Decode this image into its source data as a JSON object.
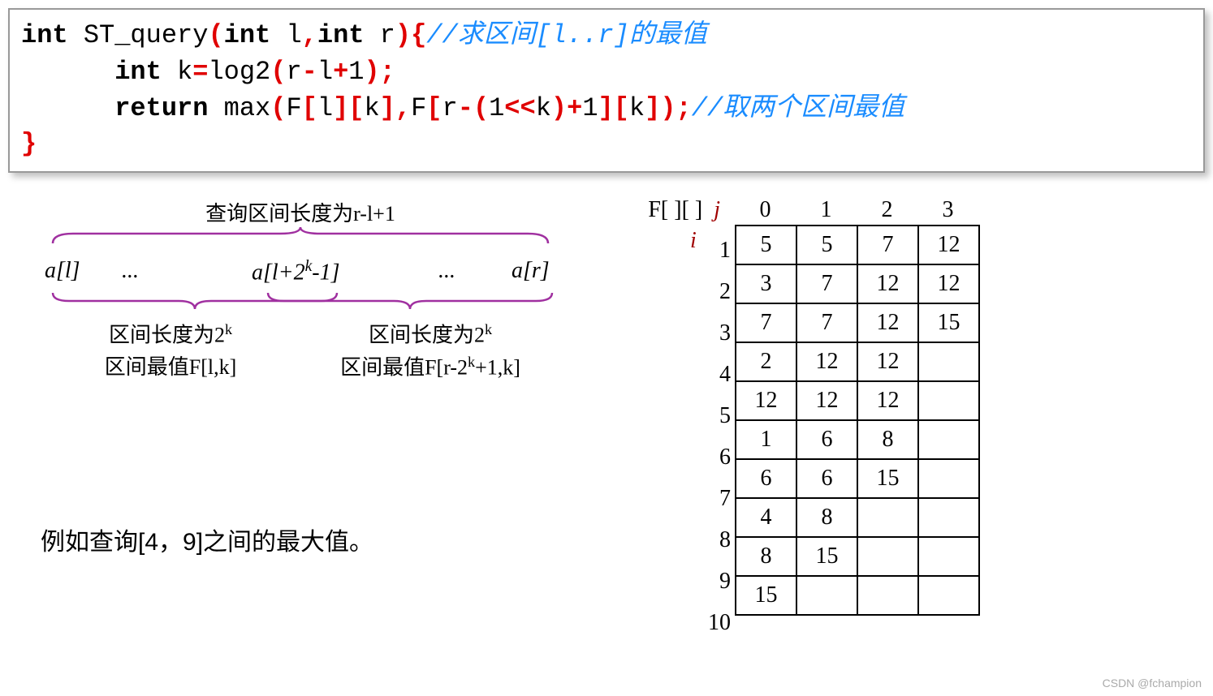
{
  "code": {
    "l1_kw1": "int",
    "l1_fn": " ST_query",
    "l1_paren_open": "(",
    "l1_kw2": "int",
    "l1_arg1": " l",
    "l1_comma": ",",
    "l1_kw3": "int",
    "l1_arg2": " r",
    "l1_paren_close": ")",
    "l1_brace": "{",
    "l1_comment": "//求区间[l..r]的最值",
    "l2_kw": "int",
    "l2_expr_a": " k",
    "l2_eq": "=",
    "l2_expr_b": "log2",
    "l2_po": "(",
    "l2_expr_c": "r",
    "l2_minus": "-",
    "l2_expr_d": "l",
    "l2_plus": "+",
    "l2_expr_e": "1",
    "l2_pc": ")",
    "l2_semi": ";",
    "l3_kw": "return",
    "l3_a": " max",
    "l3_po": "(",
    "l3_b": "F",
    "l3_br1": "[",
    "l3_c": "l",
    "l3_br2": "][",
    "l3_d": "k",
    "l3_br3": "],",
    "l3_e": "F",
    "l3_br4": "[",
    "l3_f": "r",
    "l3_minus": "-(",
    "l3_g": "1",
    "l3_shift": "<<",
    "l3_h": "k",
    "l3_cp": ")+",
    "l3_i": "1",
    "l3_br5": "][",
    "l3_j": "k",
    "l3_br6": "])",
    "l3_semi": ";",
    "l3_comment": "//取两个区间最值",
    "l4_brace": "}"
  },
  "diagram": {
    "top_label": "查询区间长度为r-l+1",
    "axis_al": "a[l]",
    "axis_dots1": "...",
    "axis_mid": "a[l+2",
    "axis_mid_sup": "k",
    "axis_mid_tail": "-1]",
    "axis_dots2": "...",
    "axis_ar": "a[r]",
    "sub_left_1a": "区间长度为2",
    "sub_left_1_sup": "k",
    "sub_left_2": "区间最值F[l,k]",
    "sub_right_1a": "区间长度为2",
    "sub_right_1_sup": "k",
    "sub_right_2a": "区间最值F[r-2",
    "sub_right_2_sup": "k",
    "sub_right_2b": "+1,k]"
  },
  "example": "例如查询[4，9]之间的最大值。",
  "table": {
    "corner": "F[ ][ ]",
    "j_label": "j",
    "i_label": "i",
    "col_headers": [
      "0",
      "1",
      "2",
      "3"
    ],
    "row_headers": [
      "1",
      "2",
      "3",
      "4",
      "5",
      "6",
      "7",
      "8",
      "9",
      "10"
    ],
    "rows": [
      [
        "5",
        "5",
        "7",
        "12"
      ],
      [
        "3",
        "7",
        "12",
        "12"
      ],
      [
        "7",
        "7",
        "12",
        "15"
      ],
      [
        "2",
        "12",
        "12",
        ""
      ],
      [
        "12",
        "12",
        "12",
        ""
      ],
      [
        "1",
        "6",
        "8",
        ""
      ],
      [
        "6",
        "6",
        "15",
        ""
      ],
      [
        "4",
        "8",
        "",
        ""
      ],
      [
        "8",
        "15",
        "",
        ""
      ],
      [
        "15",
        "",
        "",
        ""
      ]
    ]
  },
  "watermark": "CSDN @fchampion"
}
